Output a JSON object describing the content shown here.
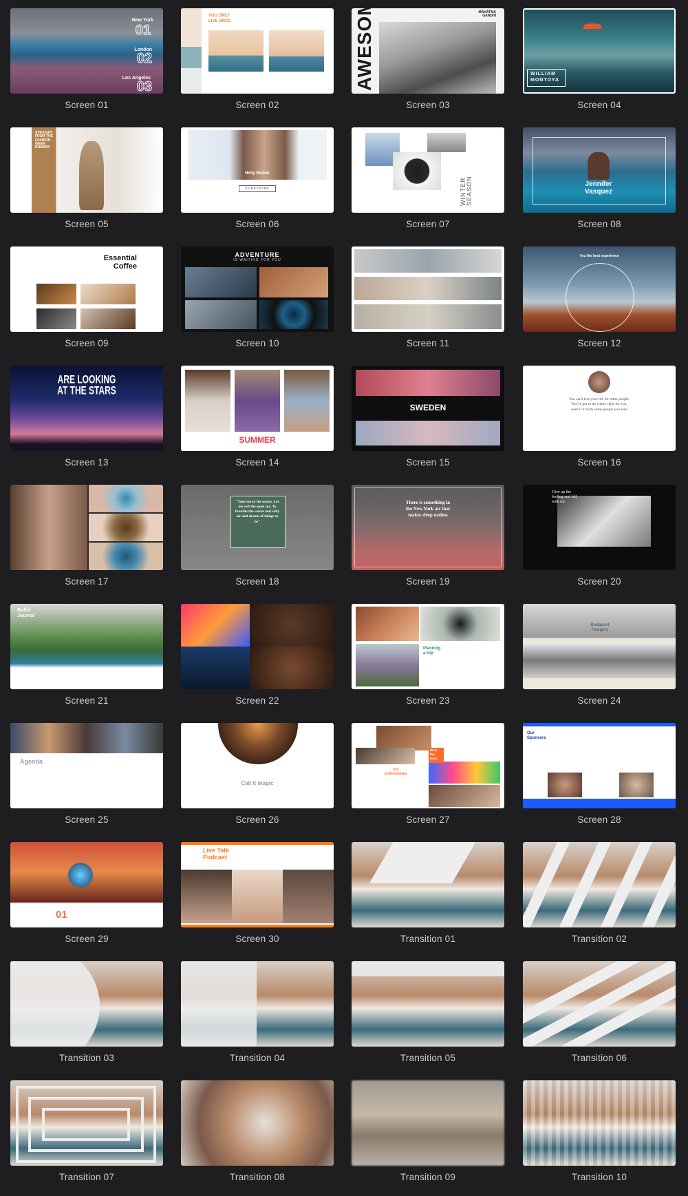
{
  "items": [
    {
      "label": "Screen 01",
      "overlay": [
        "New York",
        "01",
        "London",
        "02",
        "Los Angeles",
        "03"
      ]
    },
    {
      "label": "Screen 02",
      "overlay": [
        "YOU ONLY",
        "LIVE ONCE"
      ]
    },
    {
      "label": "Screen 03",
      "overlay": [
        "AWESOME",
        "MAHATMA GANDHI"
      ]
    },
    {
      "label": "Screen 04",
      "overlay": [
        "WILLIAM",
        "MONTOYA"
      ]
    },
    {
      "label": "Screen 05",
      "overlay": [
        "STRAIGHT FROM THE FASHION WEEK RUNWAY"
      ]
    },
    {
      "label": "Screen 06",
      "overlay": [
        "Holly Walker",
        "SUBSCRIBE"
      ]
    },
    {
      "label": "Screen 07",
      "overlay": [
        "WINTER SEASON"
      ]
    },
    {
      "label": "Screen 08",
      "overlay": [
        "Jennifer",
        "Vasquez"
      ]
    },
    {
      "label": "Screen 09",
      "overlay": [
        "Essential",
        "Coffee"
      ]
    },
    {
      "label": "Screen 10",
      "overlay": [
        "ADVENTURE",
        "IS WAITING FOR YOU"
      ]
    },
    {
      "label": "Screen 11",
      "overlay": []
    },
    {
      "label": "Screen 12",
      "overlay": [
        "You the best experience"
      ]
    },
    {
      "label": "Screen 13",
      "overlay": [
        "ARE LOOKING",
        "AT THE STARS"
      ]
    },
    {
      "label": "Screen 14",
      "overlay": [
        "SUMMER"
      ]
    },
    {
      "label": "Screen 15",
      "overlay": [
        "SWEDEN"
      ]
    },
    {
      "label": "Screen 16",
      "overlay": [
        "You can't live your life for other people. You've got to do what's right for you, even if it hurts some people you love"
      ]
    },
    {
      "label": "Screen 17",
      "overlay": []
    },
    {
      "label": "Screen 18",
      "overlay": [
        "\"Take me to the ocean. Let me sail the open sea. To breathe the warm and salty air and dream of things to be\""
      ]
    },
    {
      "label": "Screen 19",
      "overlay": [
        "There is something in the New York air that makes sleep useless"
      ]
    },
    {
      "label": "Screen 20",
      "overlay": [
        "Give up the feeling and fall with me"
      ]
    },
    {
      "label": "Screen 21",
      "overlay": [
        "Bullet",
        "Journal"
      ]
    },
    {
      "label": "Screen 22",
      "overlay": []
    },
    {
      "label": "Screen 23",
      "overlay": [
        "Planning",
        "a trip"
      ]
    },
    {
      "label": "Screen 24",
      "overlay": [
        "Budapest",
        "Hungary"
      ]
    },
    {
      "label": "Screen 25",
      "overlay": [
        "Agenda"
      ]
    },
    {
      "label": "Screen 26",
      "overlay": [
        "Call it magic"
      ]
    },
    {
      "label": "Screen 27",
      "overlay": [
        "Meet",
        "the",
        "team",
        "Our",
        "professionals"
      ]
    },
    {
      "label": "Screen 28",
      "overlay": [
        "Our",
        "Sponsors"
      ]
    },
    {
      "label": "Screen 29",
      "overlay": [
        "01"
      ]
    },
    {
      "label": "Screen 30",
      "overlay": [
        "Live Talk",
        "Podcast"
      ]
    },
    {
      "label": "Transition 01",
      "overlay": []
    },
    {
      "label": "Transition 02",
      "overlay": []
    },
    {
      "label": "Transition 03",
      "overlay": []
    },
    {
      "label": "Transition 04",
      "overlay": []
    },
    {
      "label": "Transition 05",
      "overlay": []
    },
    {
      "label": "Transition 06",
      "overlay": []
    },
    {
      "label": "Transition 07",
      "overlay": []
    },
    {
      "label": "Transition 08",
      "overlay": []
    },
    {
      "label": "Transition 09",
      "overlay": []
    },
    {
      "label": "Transition 10",
      "overlay": []
    }
  ]
}
